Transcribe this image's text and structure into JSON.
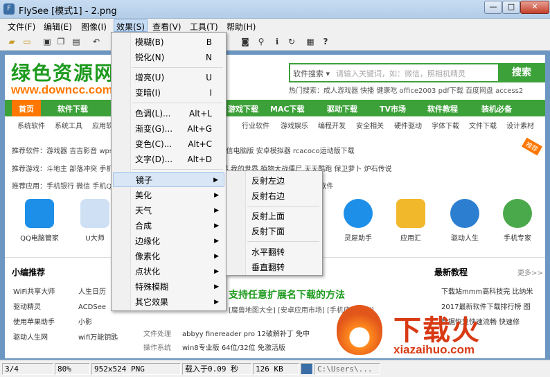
{
  "window": {
    "title": "FlySee [模式1] - 2.png",
    "minimize": "—",
    "maximize": "□",
    "close": "✕"
  },
  "menubar": [
    "文件(F)",
    "编辑(E)",
    "图像(I)",
    "效果(S)",
    "查看(V)",
    "工具(T)",
    "帮助(H)"
  ],
  "effects_menu": {
    "items": [
      {
        "label": "模糊(B)",
        "shortcut": "B"
      },
      {
        "label": "锐化(N)",
        "shortcut": "N"
      },
      {
        "label": "增亮(U)",
        "shortcut": "U"
      },
      {
        "label": "变暗(I)",
        "shortcut": "I"
      },
      {
        "label": "色调(L)...",
        "shortcut": "Alt+L"
      },
      {
        "label": "渐变(G)...",
        "shortcut": "Alt+G"
      },
      {
        "label": "变色(C)...",
        "shortcut": "Alt+C"
      },
      {
        "label": "文字(D)...",
        "shortcut": "Alt+D"
      },
      {
        "label": "镜子",
        "shortcut": "▶"
      },
      {
        "label": "美化",
        "shortcut": "▶"
      },
      {
        "label": "天气",
        "shortcut": "▶"
      },
      {
        "label": "合成",
        "shortcut": "▶"
      },
      {
        "label": "边缘化",
        "shortcut": "▶"
      },
      {
        "label": "像素化",
        "shortcut": "▶"
      },
      {
        "label": "点状化",
        "shortcut": "▶"
      },
      {
        "label": "特殊模糊",
        "shortcut": "▶"
      },
      {
        "label": "其它效果",
        "shortcut": "▶"
      }
    ]
  },
  "mirror_submenu": [
    "反射左边",
    "反射右边",
    "反射上面",
    "反射下面",
    "水平翻转",
    "垂直翻转"
  ],
  "status": {
    "page": "3/4",
    "zoom": "80%",
    "info": "952x524 PNG",
    "load": "载入于0.09 秒",
    "size": "126 KB",
    "path": "C:\\Users\\..."
  },
  "site": {
    "logo": "绿色资源网",
    "url": "www.downcc.com",
    "search_select": "软件搜索 ▾",
    "search_placeholder": "请输入关键词，如：微信，照相机精灵",
    "search_button": "搜索",
    "hotwords": "热门搜索：成人游戏器 快播 健康吃 office2003 pdf下载 百度网盘 access2",
    "nav": [
      "首页",
      "软件下载",
      "游戏下载",
      "MAC下载",
      "驱动下载",
      "TV市场",
      "软件教程",
      "装机必备"
    ],
    "subnav": [
      "系统软件",
      "系统工具",
      "应用软件",
      "行业软件",
      "游戏娱乐",
      "编程开发",
      "安全相关",
      "硬件驱动",
      "字体下载",
      "文件下载",
      "设计素材"
    ],
    "row1": "推荐软件：游戏器 吉吉影音 wps 卡巴斯基破解版 itunes 刷机助手 微信电脑版 安卓模拟器 rcacoco运动版下载",
    "row2": "推荐游戏：斗地主 部落冲突 手机游戏 火线大脑迷你英雄联盟 魔兽世界 我的世界 植物大战僵尸 天天酷跑 保卫萝卜 炉石传说",
    "row3": "推荐应用：手机银行 微信 手机QQ 掌上生活 手机淘宝 手机炒股软件 人人贷 爱奇艺 手机输入法 理财软件",
    "badge": "推荐",
    "apps": [
      "QQ电脑管家",
      "U大师",
      "灵犀助手",
      "应用汇",
      "驱动人生",
      "手机专家"
    ],
    "left_title": "小编推荐",
    "left_list": [
      "WiFi共享大师",
      "驱动精灵",
      "使用苹果助手",
      "驱动人生网"
    ],
    "left_list2": [
      "人生日历",
      "ACDSee",
      "小影",
      "wifi万能钥匙"
    ],
    "center_headline": "支持任意扩展名下载的方法",
    "center_line": "[魔兽地图大全] [安卓应用市场] [手机应用商店]",
    "center_cats": [
      "文件处理",
      "操作系统"
    ],
    "center_items": [
      "abbyy finereader pro 12破解补丁 免中",
      "win8专业版 64位/32位 免激活版"
    ],
    "right_title": "最新教程",
    "more": "更多>>",
    "right_list": [
      "下载站mmm高科技完 比纳米",
      "2017最新软件下载排行榜 图",
      "数据恢复快速流畅 快速修"
    ],
    "watermark_text": "下载火",
    "watermark_url": "xiazaihuo.com"
  }
}
